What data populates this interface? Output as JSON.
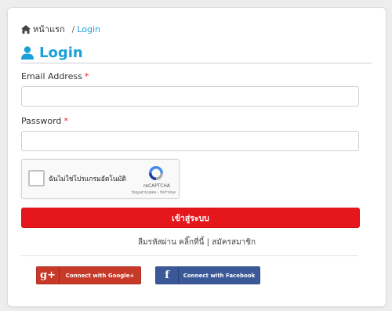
{
  "breadcrumb": {
    "home": "หน้าแรก",
    "separator": "/",
    "current": "Login"
  },
  "title": "Login",
  "form": {
    "email_label": "Email Address",
    "password_label": "Password",
    "required_mark": "*",
    "email_value": "",
    "password_value": ""
  },
  "captcha": {
    "checkbox_text": "ฉันไม่ใช่โปรแกรมอัตโนมัติ",
    "brand": "reCAPTCHA",
    "privacy": "ข้อมูลส่วนบุคคล - ข้อกำหนด"
  },
  "login_button": "เข้าสู่ระบบ",
  "links": {
    "forgot": "ลืมรหัสผ่าน คลิ๊กที่นี้",
    "divider": "|",
    "register": "สมัครสมาชิก"
  },
  "social": {
    "google_icon": "g+",
    "google": "Connect with Google+",
    "facebook_icon": "f",
    "facebook": "Connect with Facebook"
  },
  "colors": {
    "accent": "#1ba1d8",
    "login_button": "#e5171d",
    "google": "#c73a2a",
    "facebook": "#3b5998"
  }
}
